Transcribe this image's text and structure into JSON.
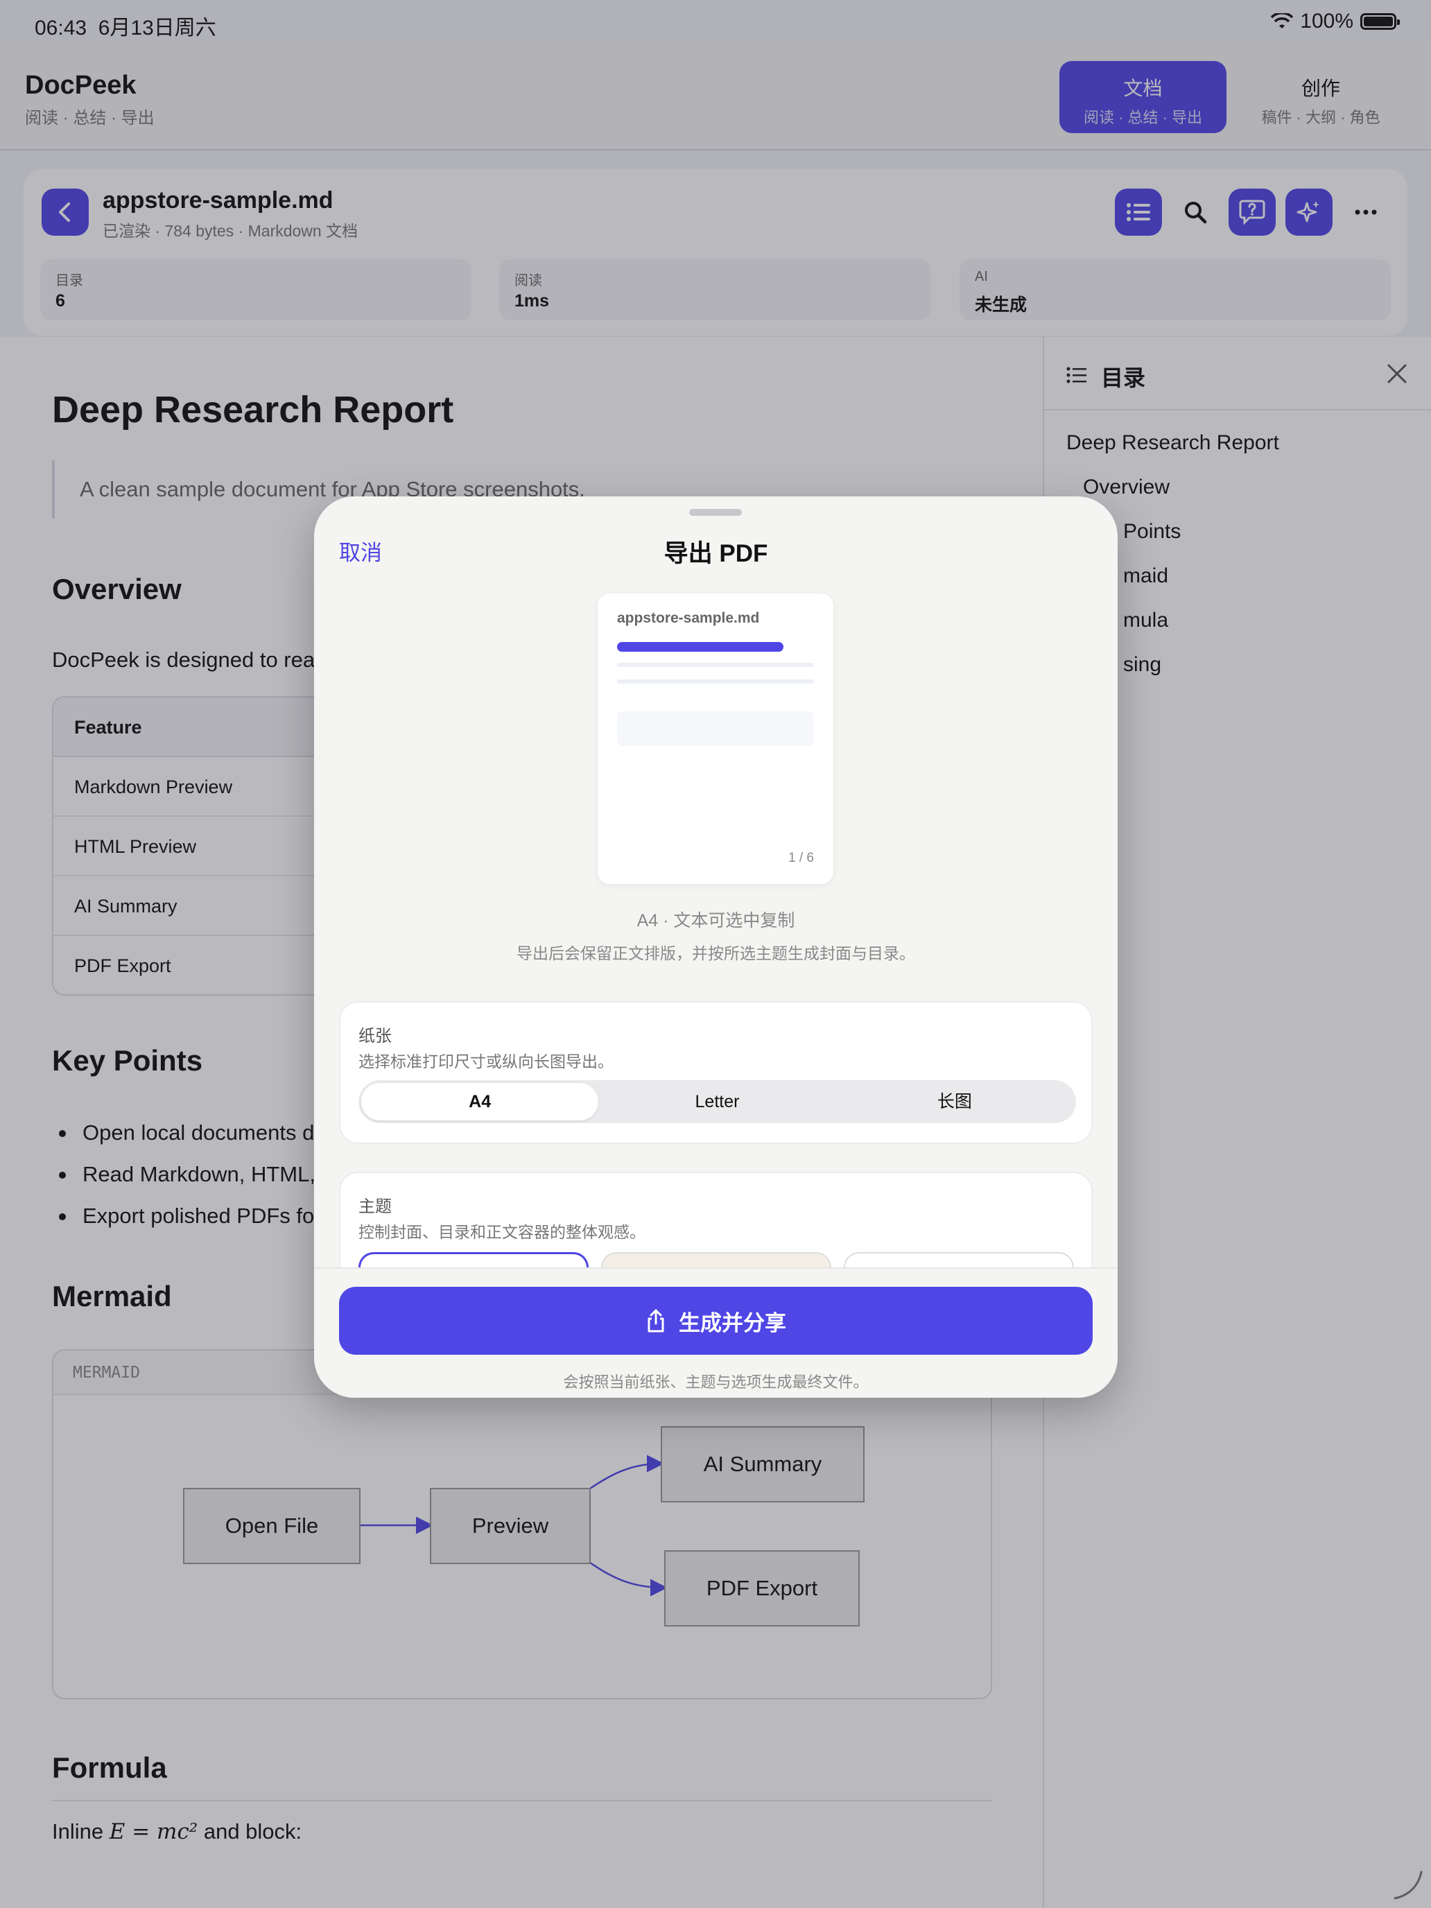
{
  "status": {
    "time": "06:43",
    "date": "6月13日周六",
    "battery": "100%"
  },
  "app": {
    "title": "DocPeek",
    "subtitle": "阅读 · 总结 · 导出"
  },
  "modes": {
    "doc": {
      "label": "文档",
      "sub": "阅读 · 总结 · 导出"
    },
    "create": {
      "label": "创作",
      "sub": "稿件 · 大纲 · 角色"
    }
  },
  "document": {
    "name": "appstore-sample.md",
    "meta": "已渲染 · 784 bytes · Markdown 文档",
    "stats": [
      {
        "key": "目录",
        "value": "6"
      },
      {
        "key": "阅读",
        "value": "1ms"
      },
      {
        "key": "AI",
        "value": "未生成"
      }
    ]
  },
  "article": {
    "title": "Deep Research Report",
    "quote": "A clean sample document for App Store screenshots.",
    "overview_heading": "Overview",
    "overview_text": "DocPeek is designed to rea",
    "table": {
      "header": "Feature",
      "rows": [
        "Markdown Preview",
        "HTML Preview",
        "AI Summary",
        "PDF Export"
      ]
    },
    "keypoints_heading": "Key Points",
    "bullets": [
      "Open local documents d",
      "Read Markdown, HTML,",
      "Export polished PDFs fo"
    ],
    "mermaid_heading": "Mermaid",
    "mermaid_label": "MERMAID",
    "nodes": {
      "open": "Open File",
      "preview": "Preview",
      "summary": "AI Summary",
      "export": "PDF Export"
    },
    "formula_heading": "Formula",
    "formula_prefix": "Inline ",
    "formula_expr": "E = mc²",
    "formula_suffix": " and block:"
  },
  "toc": {
    "title": "目录",
    "items": [
      "Deep Research Report",
      "Overview",
      "Points",
      "maid",
      "mula",
      "sing"
    ]
  },
  "export_sheet": {
    "cancel": "取消",
    "title": "导出 PDF",
    "preview_file": "appstore-sample.md",
    "preview_page": "1 / 6",
    "info": "A4 · 文本可选中复制",
    "info_detail": "导出后会保留正文排版，并按所选主题生成封面与目录。",
    "paper": {
      "title": "纸张",
      "desc": "选择标准打印尺寸或纵向长图导出。",
      "options": [
        "A4",
        "Letter",
        "长图"
      ],
      "selected": "A4"
    },
    "theme": {
      "title": "主题",
      "desc": "控制封面、目录和正文容器的整体观感。"
    },
    "primary_button": "生成并分享",
    "footnote": "会按照当前纸张、主题与选项生成最终文件。"
  },
  "colors": {
    "accent": "#4f46e5"
  }
}
